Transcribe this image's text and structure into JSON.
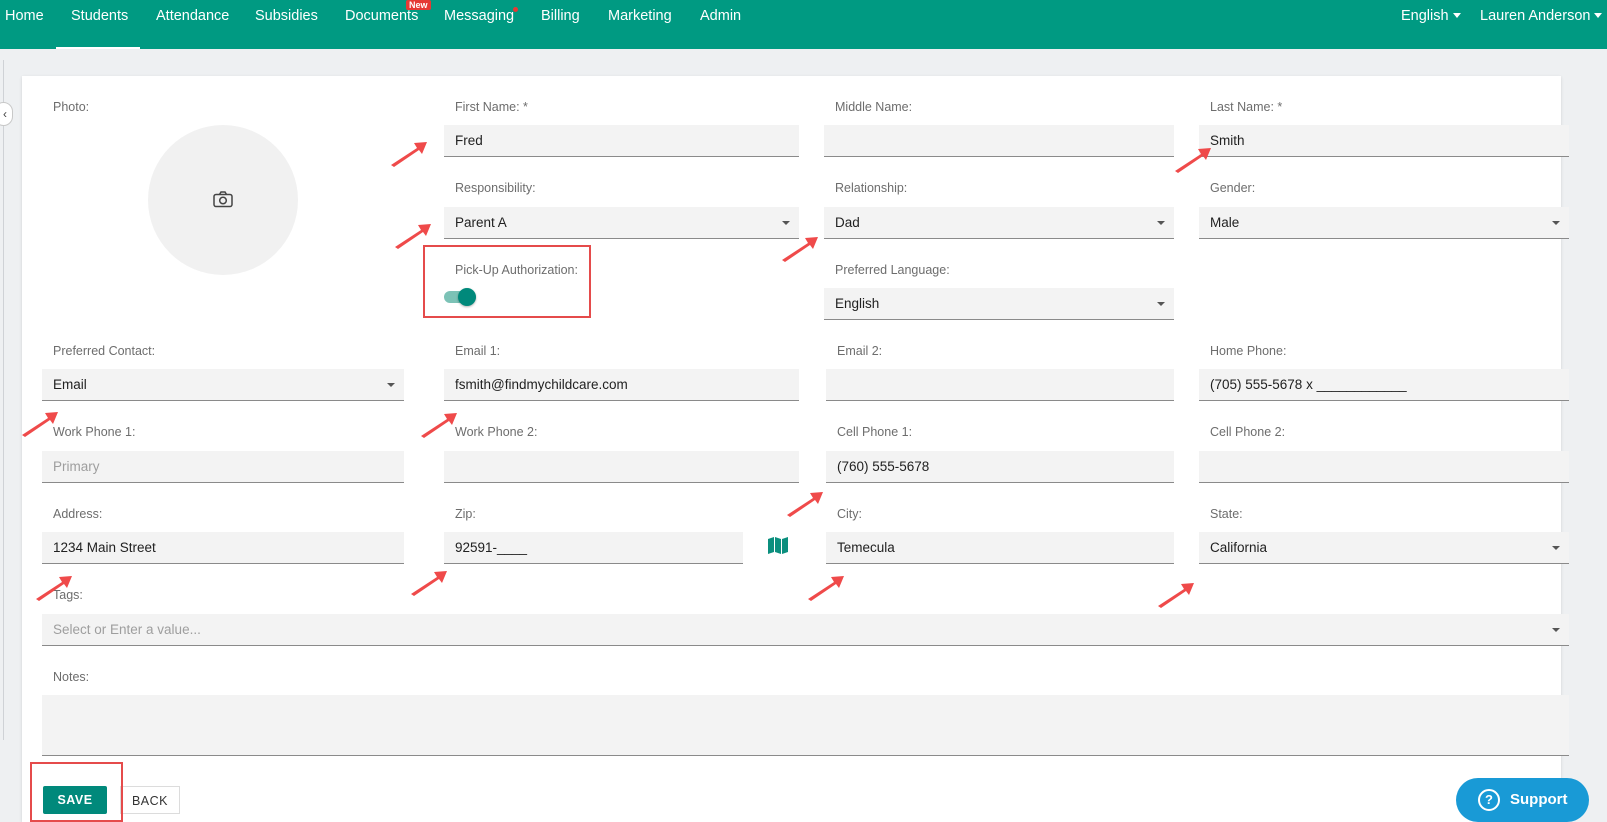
{
  "nav": {
    "items": [
      {
        "label": "Home"
      },
      {
        "label": "Students"
      },
      {
        "label": "Attendance"
      },
      {
        "label": "Subsidies"
      },
      {
        "label": "Documents"
      },
      {
        "label": "Messaging"
      },
      {
        "label": "Billing"
      },
      {
        "label": "Marketing"
      },
      {
        "label": "Admin"
      }
    ],
    "active": "Students",
    "new_badge": "New",
    "language": "English",
    "user": "Lauren Anderson"
  },
  "form": {
    "photo_label": "Photo:",
    "first_name": {
      "label": "First Name: *",
      "value": "Fred"
    },
    "middle_name": {
      "label": "Middle Name:",
      "value": ""
    },
    "last_name": {
      "label": "Last Name: *",
      "value": "Smith"
    },
    "responsibility": {
      "label": "Responsibility:",
      "value": "Parent A"
    },
    "relationship": {
      "label": "Relationship:",
      "value": "Dad"
    },
    "gender": {
      "label": "Gender:",
      "value": "Male"
    },
    "pickup_authorization": {
      "label": "Pick-Up Authorization:",
      "enabled": true
    },
    "preferred_language": {
      "label": "Preferred Language:",
      "value": "English"
    },
    "preferred_contact": {
      "label": "Preferred Contact:",
      "value": "Email"
    },
    "email1": {
      "label": "Email 1:",
      "value": "fsmith@findmychildcare.com"
    },
    "email2": {
      "label": "Email 2:",
      "value": ""
    },
    "home_phone": {
      "label": "Home Phone:",
      "value": "(705) 555-5678 x ____________"
    },
    "work_phone1": {
      "label": "Work Phone 1:",
      "placeholder": "Primary"
    },
    "work_phone2": {
      "label": "Work Phone 2:",
      "value": ""
    },
    "cell_phone1": {
      "label": "Cell Phone 1:",
      "value": "(760) 555-5678"
    },
    "cell_phone2": {
      "label": "Cell Phone 2:",
      "value": ""
    },
    "address": {
      "label": "Address:",
      "value": "1234 Main Street"
    },
    "zip": {
      "label": "Zip:",
      "value": "92591-____"
    },
    "city": {
      "label": "City:",
      "value": "Temecula"
    },
    "state": {
      "label": "State:",
      "value": "California"
    },
    "tags": {
      "label": "Tags:",
      "placeholder": "Select or Enter a value..."
    },
    "notes": {
      "label": "Notes:",
      "value": ""
    }
  },
  "buttons": {
    "save": "SAVE",
    "back": "BACK"
  },
  "support": {
    "label": "Support",
    "icon": "?"
  },
  "colors": {
    "brand": "#009a82",
    "accent": "#00897b",
    "annotation": "#e54b4b",
    "support": "#199ad6"
  }
}
